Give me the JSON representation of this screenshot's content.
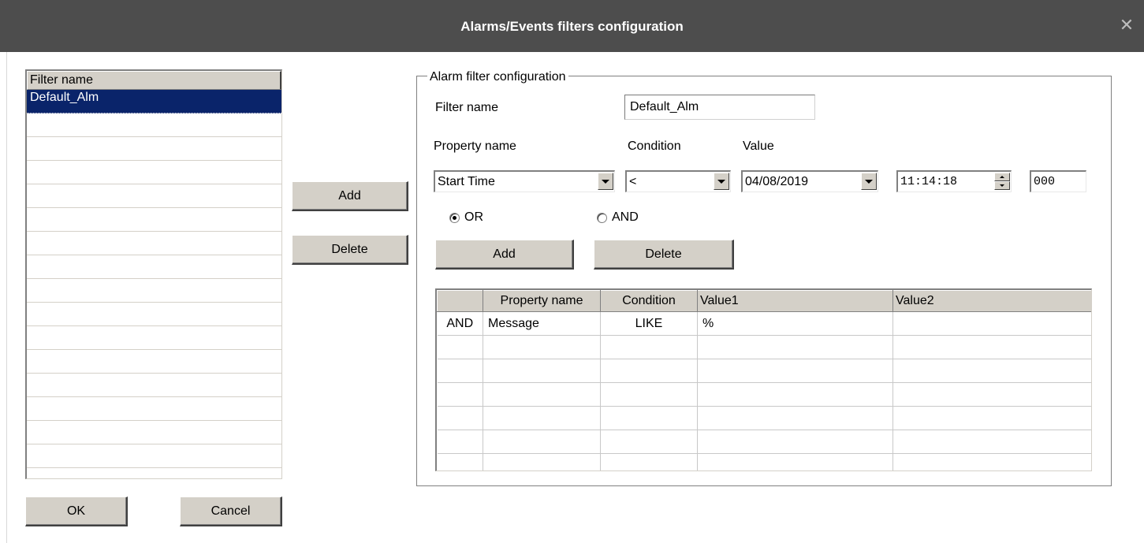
{
  "window": {
    "title": "Alarms/Events filters configuration",
    "close_glyph": "✕"
  },
  "filter_list": {
    "header": "Filter name",
    "items": [
      "Default_Alm",
      "",
      "",
      "",
      "",
      "",
      "",
      "",
      "",
      "",
      "",
      "",
      "",
      "",
      "",
      "",
      ""
    ],
    "selected_index": 0
  },
  "list_buttons": {
    "add": "Add",
    "delete": "Delete"
  },
  "footer_buttons": {
    "ok": "OK",
    "cancel": "Cancel"
  },
  "config": {
    "group_title": "Alarm filter configuration",
    "filter_name_label": "Filter name",
    "filter_name_value": "Default_Alm",
    "property_label": "Property name",
    "condition_label": "Condition",
    "value_label": "Value",
    "property_value": "Start Time",
    "condition_value": "<",
    "date_value": "04/08/2019",
    "time_value": "11:14:18",
    "ms_value": "000",
    "or_label": "OR",
    "and_label": "AND",
    "logic_selected": "OR",
    "add_label": "Add",
    "delete_label": "Delete"
  },
  "grid": {
    "columns": [
      "",
      "Property name",
      "Condition",
      "Value1",
      "Value2"
    ],
    "rows": [
      [
        "AND",
        "Message",
        "LIKE",
        "%",
        ""
      ],
      [
        "",
        "",
        "",
        "",
        ""
      ],
      [
        "",
        "",
        "",
        "",
        ""
      ],
      [
        "",
        "",
        "",
        "",
        ""
      ],
      [
        "",
        "",
        "",
        "",
        ""
      ],
      [
        "",
        "",
        "",
        "",
        ""
      ],
      [
        "",
        "",
        "",
        "",
        ""
      ]
    ]
  }
}
